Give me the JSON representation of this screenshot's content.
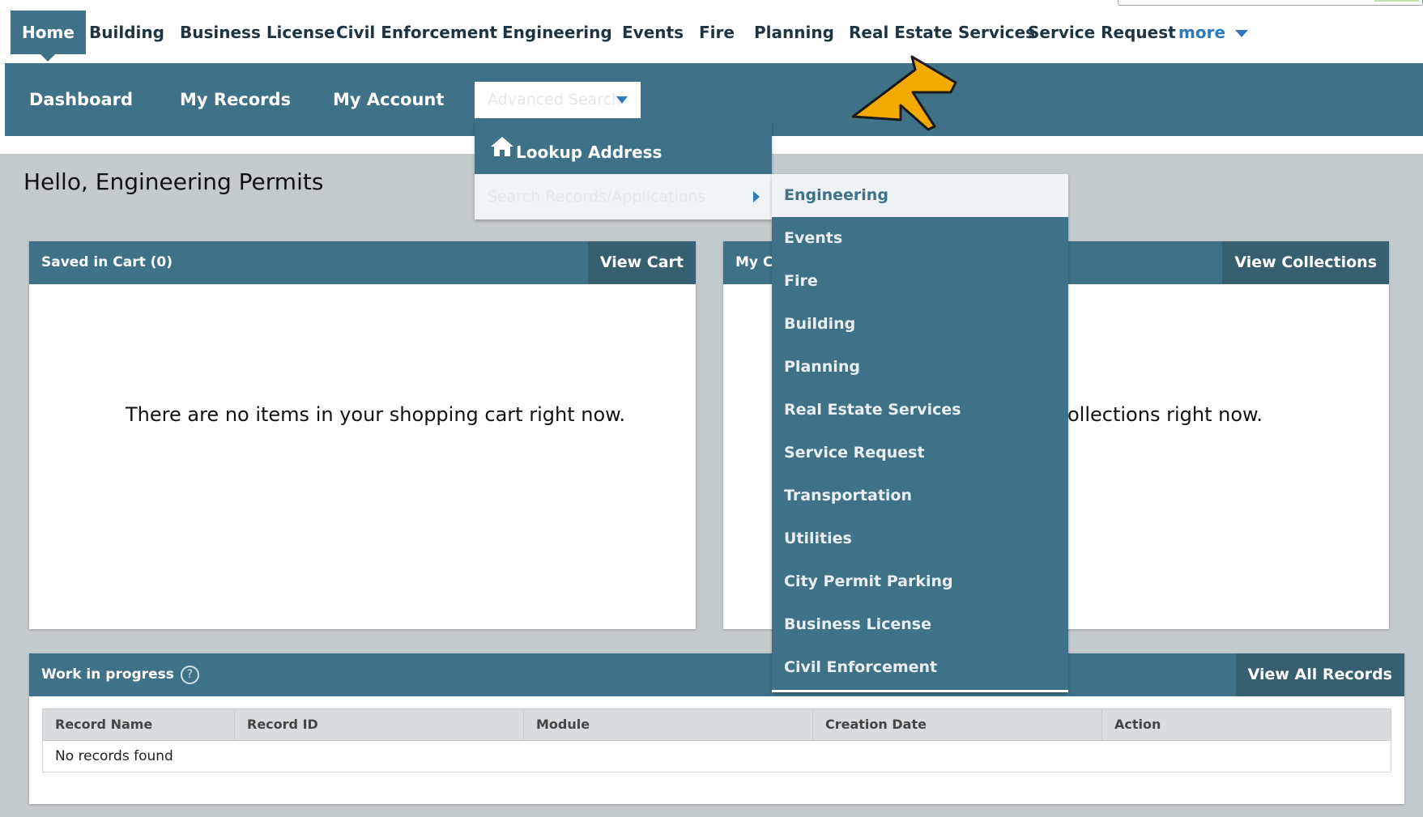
{
  "top_nav": {
    "tabs": [
      {
        "label": "Home",
        "active": true
      },
      {
        "label": "Building"
      },
      {
        "label": "Business License"
      },
      {
        "label": "Civil Enforcement"
      },
      {
        "label": "Engineering"
      },
      {
        "label": "Events"
      },
      {
        "label": "Fire"
      },
      {
        "label": "Planning"
      },
      {
        "label": "Real Estate Services"
      },
      {
        "label": "Service Request"
      }
    ],
    "more_label": "more"
  },
  "sub_nav": {
    "dashboard": "Dashboard",
    "my_records": "My Records",
    "my_account": "My Account",
    "advanced_search": "Advanced Search"
  },
  "advanced_menu": {
    "lookup_address": "Lookup Address",
    "search_records": "Search Records/Applications"
  },
  "search_submenu": [
    "Engineering",
    "Events",
    "Fire",
    "Building",
    "Planning",
    "Real Estate Services",
    "Service Request",
    "Transportation",
    "Utilities",
    "City Permit Parking",
    "Business License",
    "Civil Enforcement"
  ],
  "greeting": "Hello, Engineering Permits",
  "cart_panel": {
    "title": "Saved in Cart (0)",
    "action": "View Cart",
    "empty_message": "There are no items in your shopping cart right now."
  },
  "collections_panel": {
    "title": "My C",
    "action": "View Collections",
    "empty_message_visible": "ollections right now."
  },
  "work_panel": {
    "title": "Work in progress",
    "action": "View All Records",
    "columns": [
      "Record Name",
      "Record ID",
      "Module",
      "Creation Date",
      "Action"
    ],
    "empty_row": "No records found"
  },
  "colors": {
    "nav_teal": "#3f7188",
    "nav_teal_dark": "#375f72",
    "link_blue": "#2b7bbd",
    "page_grey": "#c4cbcf",
    "arrow_orange": "#f2a900"
  },
  "icons": [
    "home-icon",
    "help-icon",
    "chevron-down-icon",
    "chevron-right-icon",
    "pointer-arrow-icon"
  ]
}
